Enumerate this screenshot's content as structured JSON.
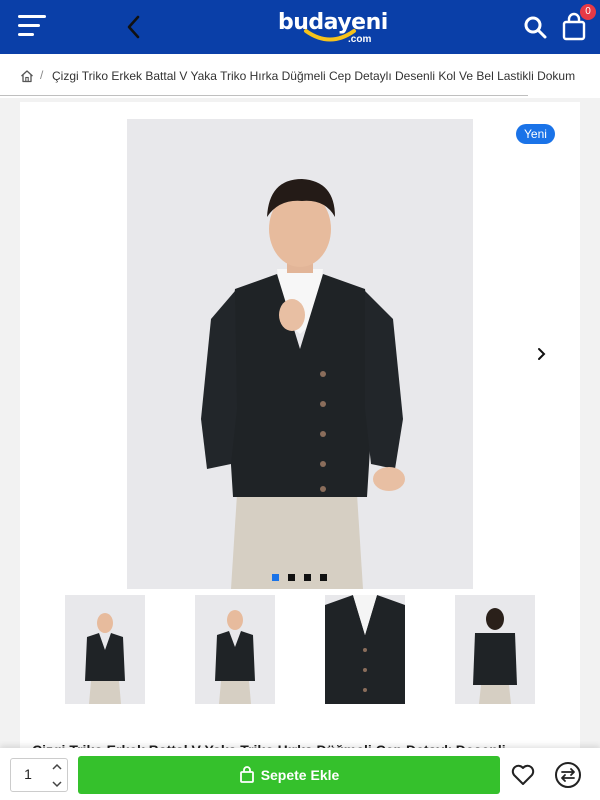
{
  "header": {
    "logo_text": "budayeni",
    "logo_sub": ".com",
    "cart_count": "0",
    "icons": [
      "menu-icon",
      "back-arrow-icon",
      "search-icon",
      "shopping-bag-icon"
    ]
  },
  "breadcrumb": {
    "separator": "/",
    "text": "Çizgi Triko Erkek Battal V Yaka Triko Hırka Düğmeli Cep Detaylı Desenli Kol Ve Bel Lastikli Dokum"
  },
  "product": {
    "badge": "Yeni",
    "image_count": 4,
    "active_image": 0,
    "title_peek": "Çizgi Triko Erkek Battal V Yaka Triko Hırka Düğmeli Cep Detaylı Desenli"
  },
  "actions": {
    "quantity": "1",
    "add_to_cart": "Sepete Ekle"
  },
  "colors": {
    "header": "#0a3fa8",
    "accent_blue": "#1a73e8",
    "add_to_cart": "#35c12c",
    "badge_red": "#e63946"
  }
}
